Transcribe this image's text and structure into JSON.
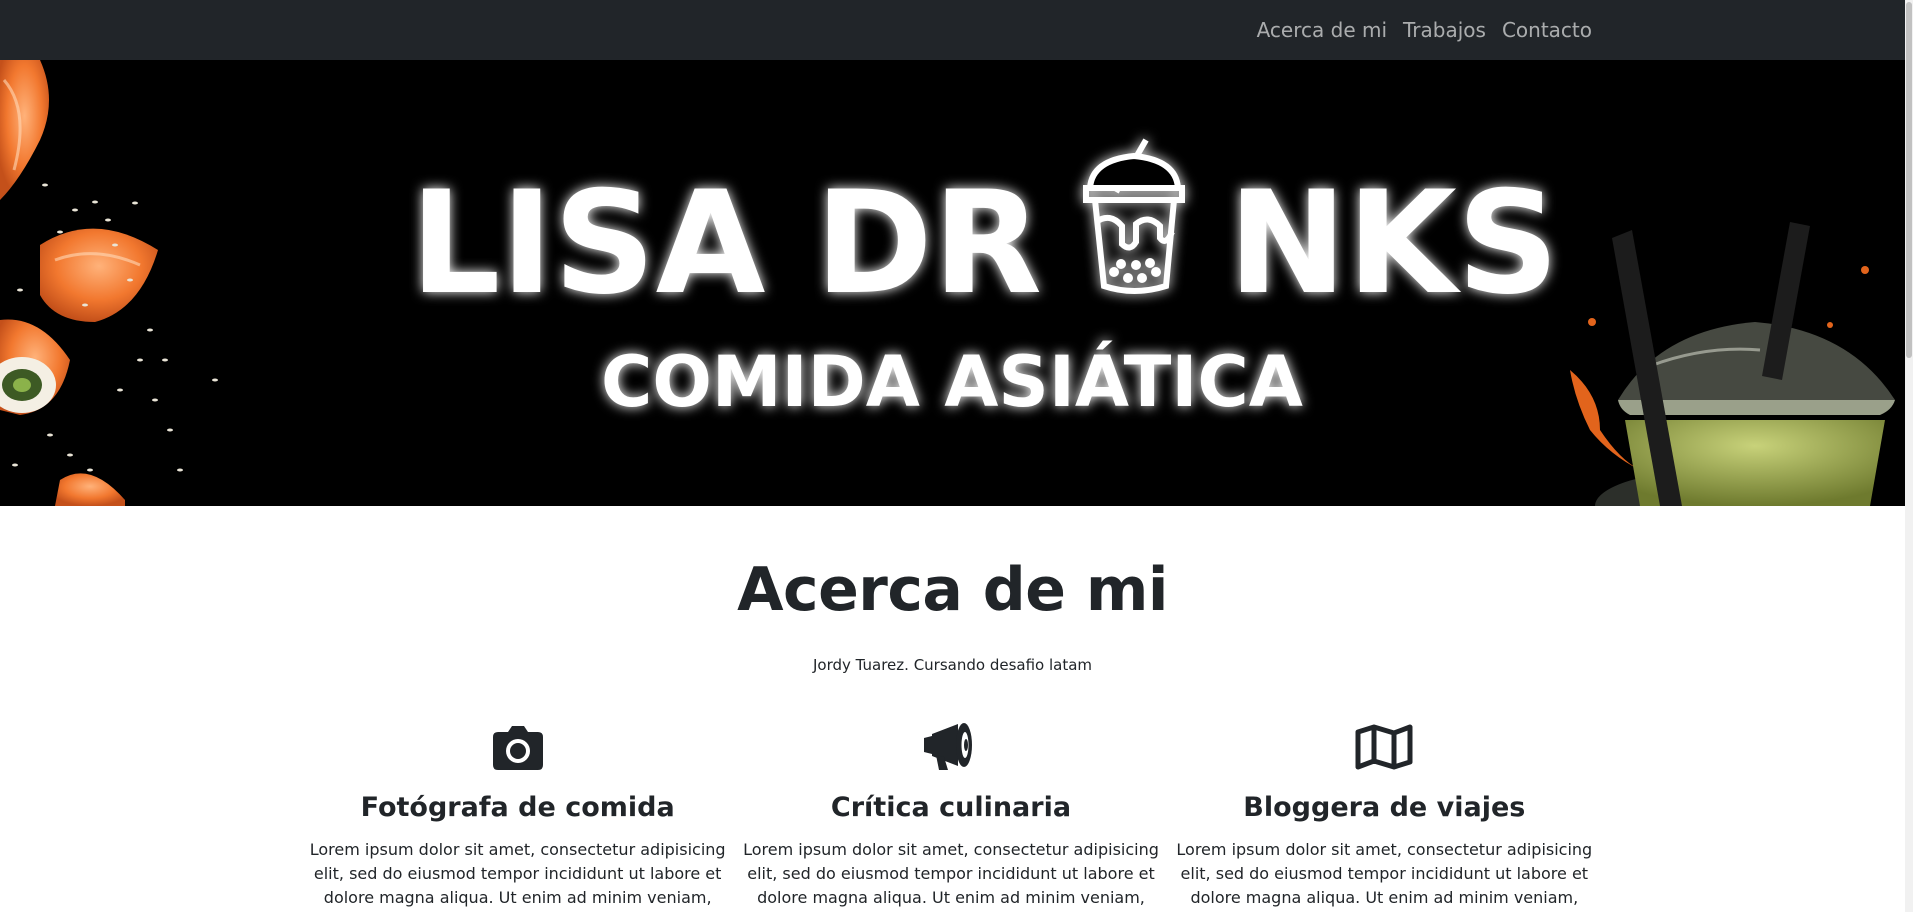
{
  "nav": {
    "items": [
      {
        "label": "Acerca de mi"
      },
      {
        "label": "Trabajos"
      },
      {
        "label": "Contacto"
      }
    ]
  },
  "hero": {
    "title_part1": "LISA DR",
    "title_part2": "NKS",
    "subtitle": "COMIDA ASIÁTICA"
  },
  "about": {
    "title": "Acerca de mi",
    "subtitle": "Jordy Tuarez. Cursando desafio latam",
    "features": [
      {
        "icon": "camera-icon",
        "title": "Fotógrafa de comida",
        "text": "Lorem ipsum dolor sit amet, consectetur adipisicing elit, sed do eiusmod tempor incididunt ut labore et dolore magna aliqua. Ut enim ad minim veniam, quis nostrud"
      },
      {
        "icon": "megaphone-icon",
        "title": "Crítica culinaria",
        "text": "Lorem ipsum dolor sit amet, consectetur adipisicing elit, sed do eiusmod tempor incididunt ut labore et dolore magna aliqua. Ut enim ad minim veniam, quis nostrud"
      },
      {
        "icon": "map-icon",
        "title": "Bloggera de viajes",
        "text": "Lorem ipsum dolor sit amet, consectetur adipisicing elit, sed do eiusmod tempor incididunt ut labore et dolore magna aliqua. Ut enim ad minim veniam, quis nostrud"
      }
    ]
  },
  "colors": {
    "navbar_bg": "#212529",
    "hero_bg": "#000000",
    "text": "#212529"
  }
}
